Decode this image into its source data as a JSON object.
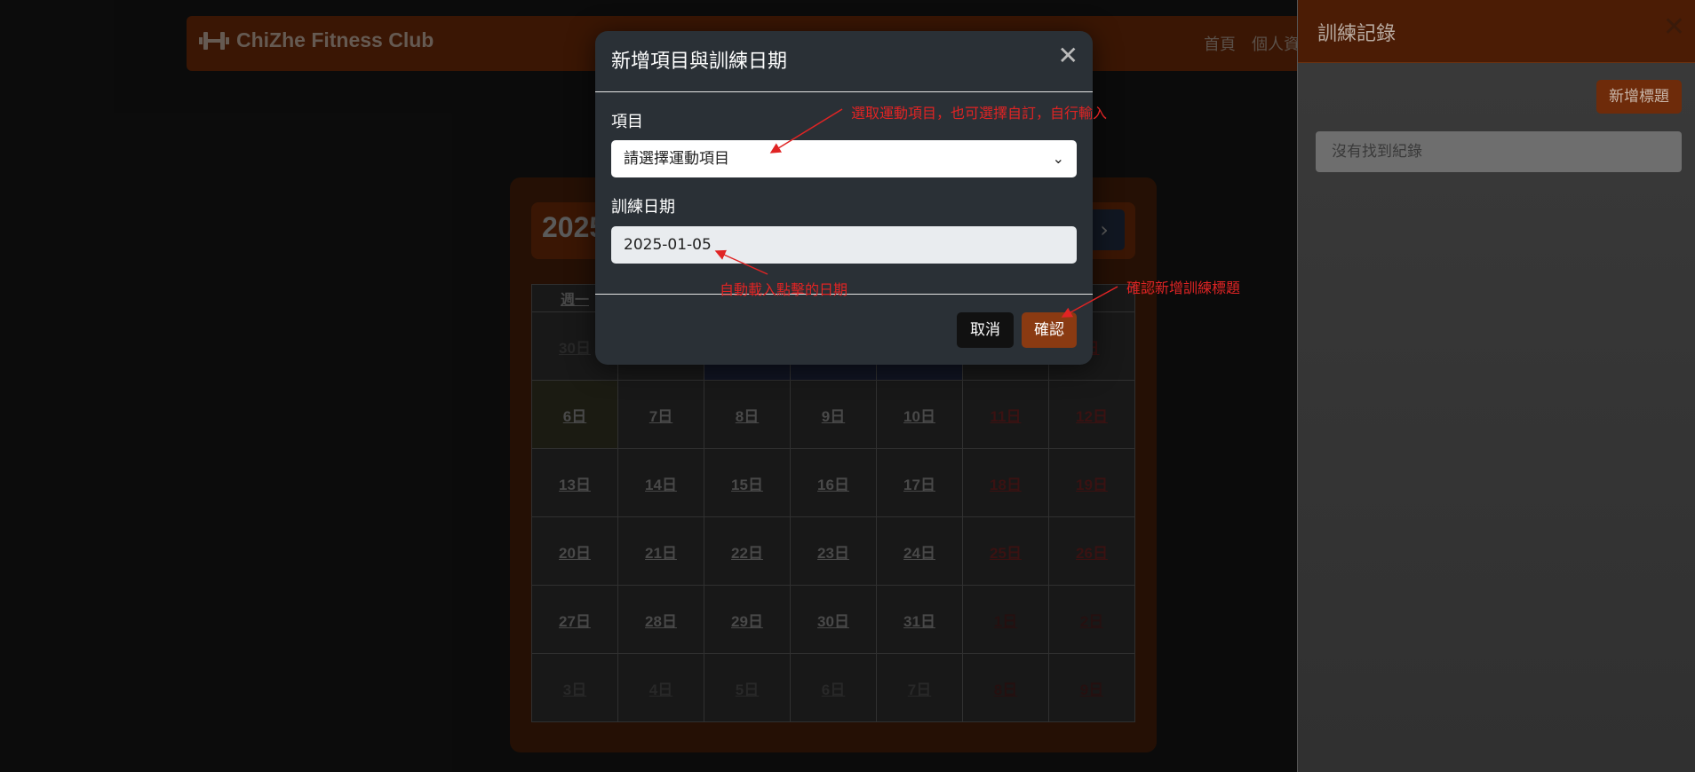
{
  "navbar": {
    "brand": "ChiZhe Fitness Club",
    "links": [
      "首頁",
      "個人資"
    ]
  },
  "calendar": {
    "year_partial": "2025",
    "next_label": "›",
    "weekday_partial": "週一",
    "rows": [
      [
        "30日",
        "",
        "",
        "",
        "",
        "",
        "日"
      ],
      [
        "6日",
        "7日",
        "8日",
        "9日",
        "10日",
        "11日",
        "12日"
      ],
      [
        "13日",
        "14日",
        "15日",
        "16日",
        "17日",
        "18日",
        "19日"
      ],
      [
        "20日",
        "21日",
        "22日",
        "23日",
        "24日",
        "25日",
        "26日"
      ],
      [
        "27日",
        "28日",
        "29日",
        "30日",
        "31日",
        "1日",
        "2日"
      ],
      [
        "3日",
        "4日",
        "5日",
        "6日",
        "7日",
        "8日",
        "9日"
      ]
    ]
  },
  "side_panel": {
    "title": "訓練記錄",
    "close_icon": "close-icon",
    "add_button": "新增標題",
    "empty_text": "沒有找到紀錄"
  },
  "modal": {
    "title": "新增項目與訓練日期",
    "item_label": "項目",
    "item_select_value": "請選擇運動項目",
    "date_label": "訓練日期",
    "date_value": "2025-01-05",
    "cancel": "取消",
    "confirm": "確認"
  },
  "annotations": {
    "select_hint": "選取運動項目，也可選擇自訂，自行輸入",
    "date_hint": "自動載入點擊的日期",
    "confirm_hint": "確認新增訓練標題",
    "color": "#e02424"
  }
}
